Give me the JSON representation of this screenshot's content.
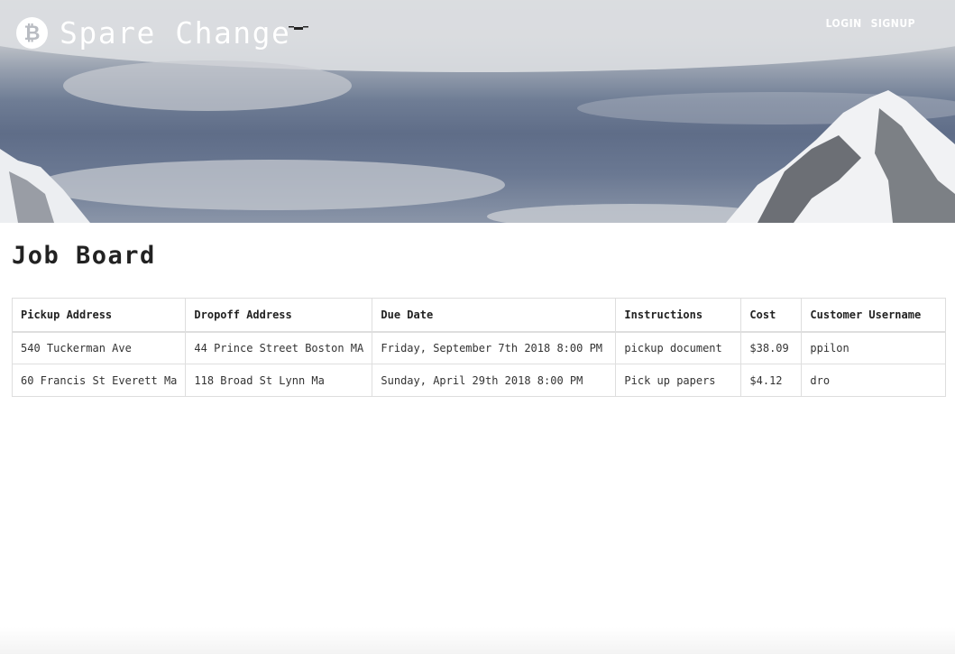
{
  "brand": {
    "name": "Spare Change",
    "icon": "bitcoin-icon",
    "icon_glyph": "₿"
  },
  "nav": {
    "login": "LOGIN",
    "signup": "SIGNUP"
  },
  "page_title": "Job Board",
  "table": {
    "columns": [
      "Pickup Address",
      "Dropoff Address",
      "Due Date",
      "Instructions",
      "Cost",
      "Customer Username"
    ],
    "rows": [
      [
        "540 Tuckerman Ave",
        "44 Prince Street Boston MA",
        "Friday, September 7th 2018 8:00 PM",
        "pickup document",
        "$38.09",
        "ppilon"
      ],
      [
        "60 Francis St Everett Ma",
        "118 Broad St Lynn Ma",
        "Sunday, April 29th 2018 8:00 PM",
        "Pick up papers",
        "$4.12",
        "dro"
      ]
    ]
  }
}
